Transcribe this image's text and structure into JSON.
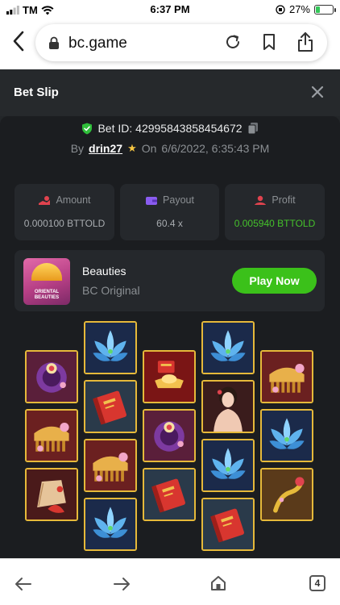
{
  "status_bar": {
    "carrier": "TM",
    "time": "6:37 PM",
    "battery": "27%",
    "battery_level": 0.27
  },
  "browser": {
    "url": "bc.game",
    "tab_count": "4"
  },
  "bet_slip": {
    "title": "Bet Slip",
    "bet_id": "Bet ID: 42995843858454672",
    "by_label": "By",
    "user": "drin27",
    "on_label": "On",
    "date": "6/6/2022, 6:35:43 PM",
    "stats": [
      {
        "label": "Amount",
        "value": "0.000100 BTTOLD",
        "icon": "dollar-hand-icon"
      },
      {
        "label": "Payout",
        "value": "60.4 x",
        "icon": "wallet-icon"
      },
      {
        "label": "Profit",
        "value": "0.005940 BTTOLD",
        "icon": "profit-icon"
      }
    ],
    "game": {
      "name": "Beauties",
      "provider": "BC Original",
      "play_label": "Play Now",
      "thumb_text": "ORIENTAL BEAUTIES"
    }
  },
  "colors": {
    "accent_green": "#3bc11a",
    "profit_green": "#45c12b",
    "frame_gold": "#e6b93a",
    "bg_dark": "#1b1d20"
  },
  "reel_symbols": [
    [
      "ring",
      "comb",
      "fish-fan"
    ],
    [
      "lotus",
      "book",
      "comb",
      "lotus"
    ],
    [
      "gold-ingot",
      "ring",
      "book"
    ],
    [
      "lotus",
      "lady",
      "lotus",
      "book"
    ],
    [
      "comb",
      "lotus",
      "hairpin"
    ]
  ]
}
